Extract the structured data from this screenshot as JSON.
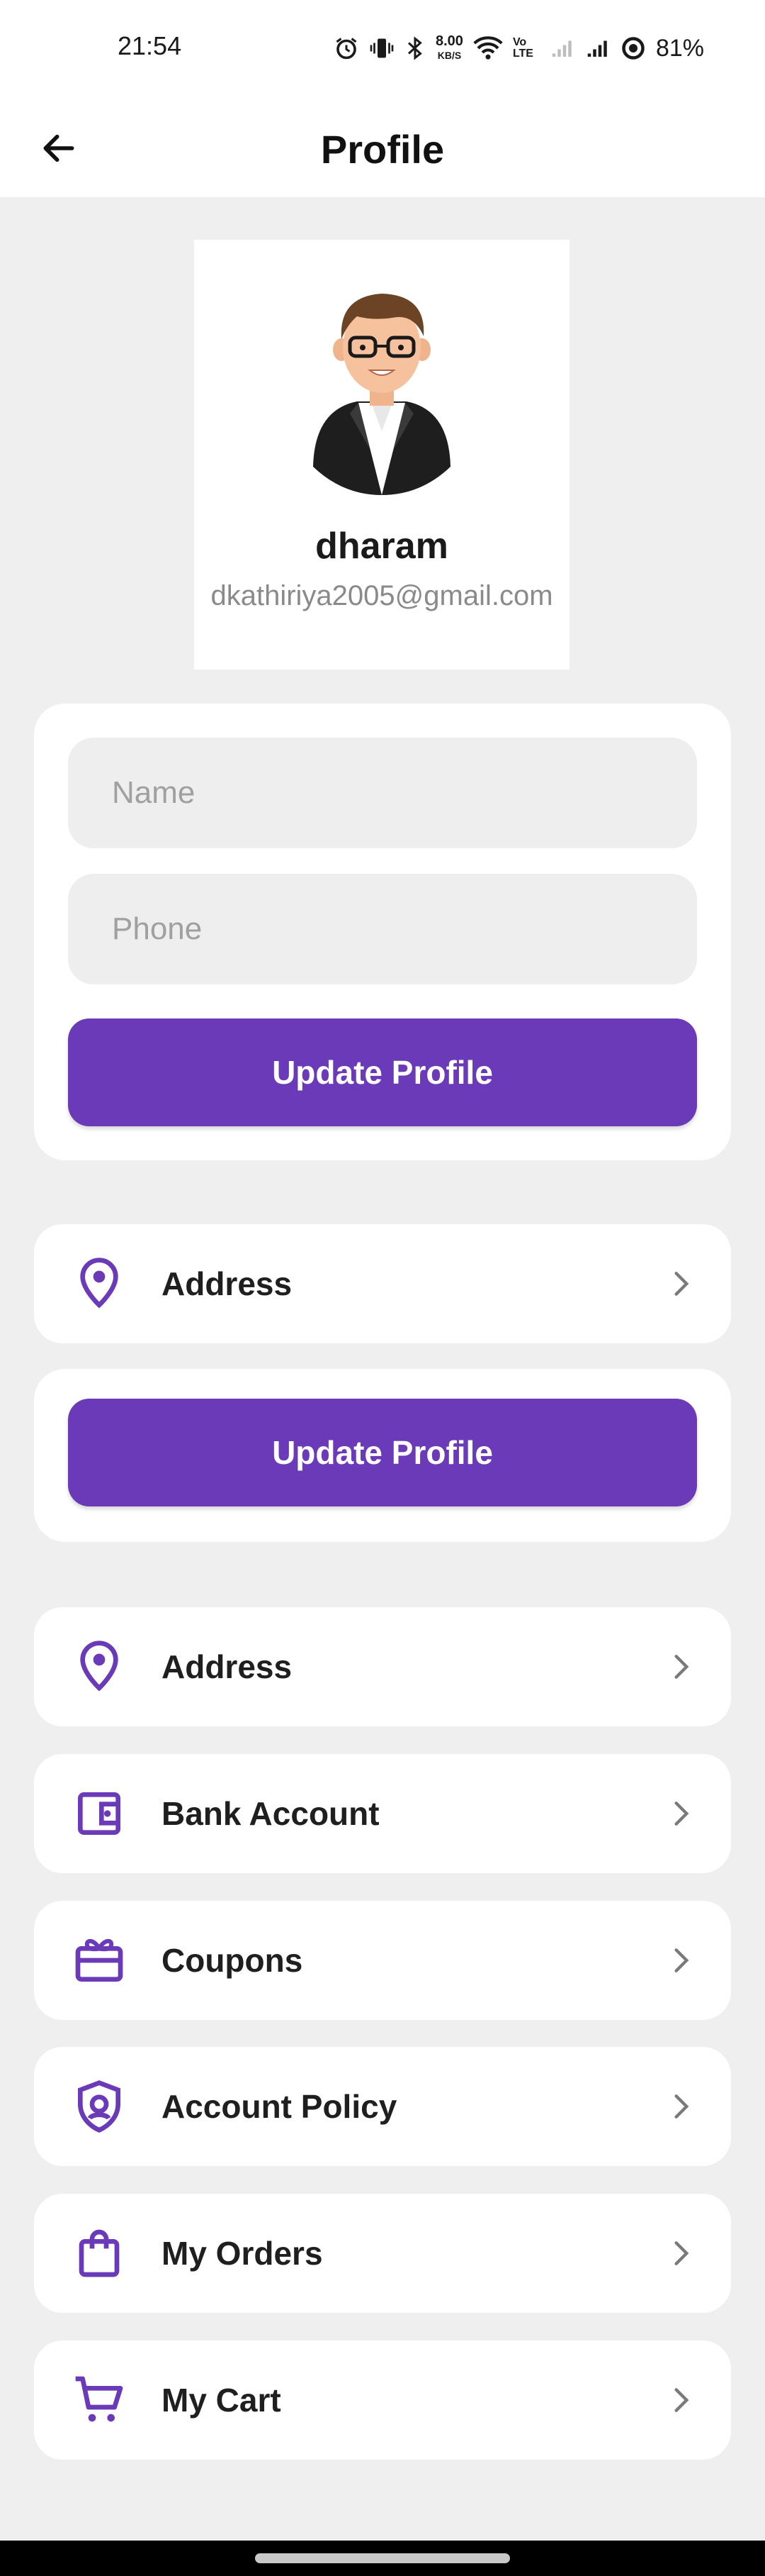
{
  "status_bar": {
    "time": "21:54",
    "net_speed_value": "8.00",
    "net_speed_unit": "KB/S",
    "volte": "Vo LTE",
    "battery": "81%"
  },
  "app_bar": {
    "title": "Profile",
    "back_icon": "arrow-back-icon"
  },
  "profile": {
    "name": "dharam",
    "email": "dkathiriya2005@gmail.com"
  },
  "form": {
    "name_placeholder": "Name",
    "phone_placeholder": "Phone",
    "update_label": "Update Profile"
  },
  "address_card": {
    "label": "Address",
    "update_label": "Update Profile"
  },
  "menu": {
    "items": [
      {
        "label": "Address",
        "icon": "location-pin-icon"
      },
      {
        "label": "Bank Account",
        "icon": "wallet-icon"
      },
      {
        "label": "Coupons",
        "icon": "gift-card-icon"
      },
      {
        "label": "Account Policy",
        "icon": "shield-icon"
      },
      {
        "label": "My Orders",
        "icon": "shopping-bag-icon"
      },
      {
        "label": "My Cart",
        "icon": "cart-icon"
      }
    ]
  },
  "colors": {
    "accent": "#6a3ab9",
    "background": "#efefef",
    "card": "#ffffff"
  }
}
